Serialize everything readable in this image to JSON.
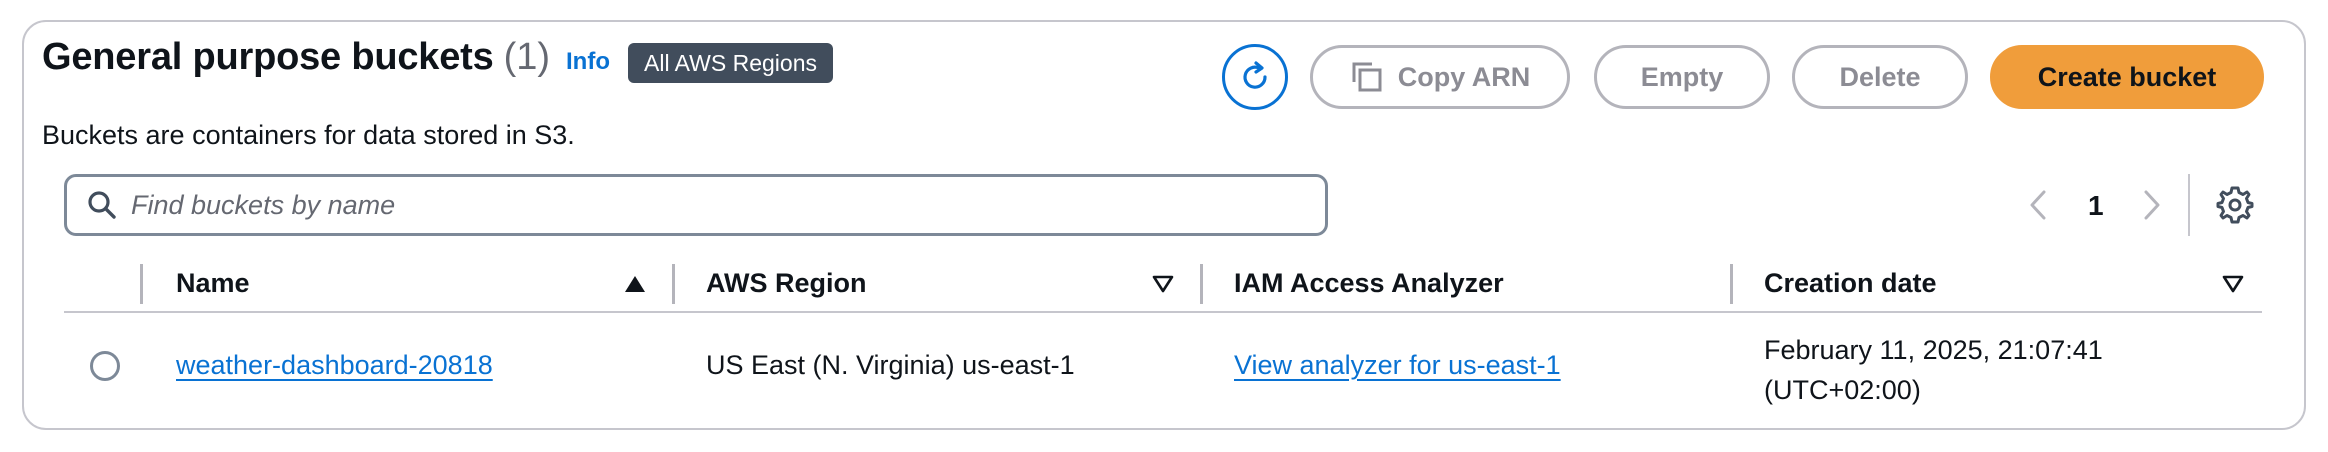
{
  "header": {
    "title": "General purpose buckets",
    "count": "(1)",
    "info_label": "Info",
    "region_badge": "All AWS Regions",
    "subtitle": "Buckets are containers for data stored in S3."
  },
  "actions": {
    "refresh_icon": "refresh-icon",
    "copy_arn_label": "Copy ARN",
    "copy_icon": "copy-icon",
    "empty_label": "Empty",
    "delete_label": "Delete",
    "create_label": "Create bucket",
    "create_color": "#f09d3b"
  },
  "search": {
    "placeholder": "Find buckets by name",
    "value": ""
  },
  "pagination": {
    "current_page": "1"
  },
  "table": {
    "columns": [
      {
        "label": "Name",
        "sort": "ascending"
      },
      {
        "label": "AWS Region",
        "sort": "none"
      },
      {
        "label": "IAM Access Analyzer",
        "sort": "none"
      },
      {
        "label": "Creation date",
        "sort": "none"
      }
    ],
    "rows": [
      {
        "selected": false,
        "name": "weather-dashboard-20818",
        "region": "US East (N. Virginia) us-east-1",
        "analyzer_link": "View analyzer for us-east-1",
        "creation_date_line1": "February 11, 2025, 21:07:41",
        "creation_date_line2": "(UTC+02:00)"
      }
    ]
  },
  "colors": {
    "link": "#0972d3",
    "badge_bg": "#414d5c",
    "text": "#0f141a"
  }
}
